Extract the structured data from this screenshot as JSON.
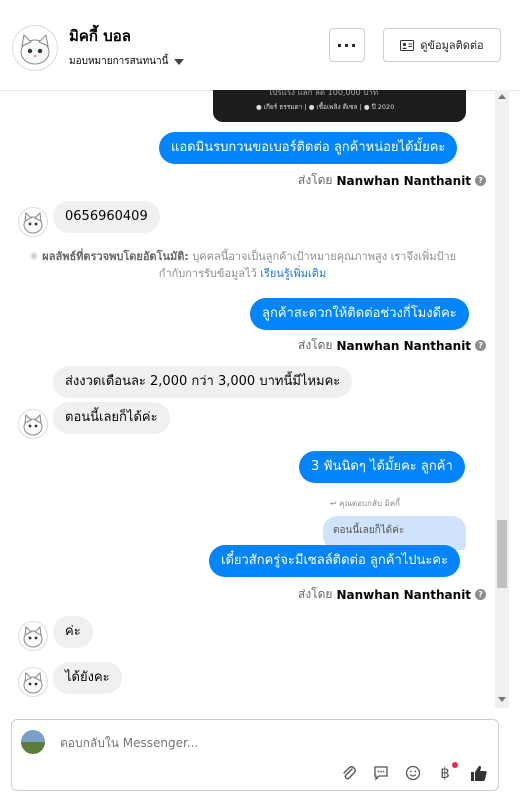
{
  "header": {
    "name": "มิคกี้ บอล",
    "assign_label": "มอบหมายการสนทนานี้",
    "more_label": "···",
    "contact_info_label": "ดูข้อมูลติดต่อ"
  },
  "promo": {
    "line1": "โปรแรง แลก ลด 100,000 บาท",
    "line2": "● เกียร์ ธรรมดา  |  ● เชื้อเพลิง ดีเซล  |  ● ปี 2020"
  },
  "messages": {
    "m1": "แอดมินรบกวนขอเบอร์ติดต่อ ลูกค้าหน่อยได้มั้ยคะ",
    "m2": "0656960409",
    "m3": "ลูกค้าสะดวกให้ติดต่อช่วงกี่โมงดีคะ",
    "m4": "ส่งงวดเดือนละ 2,000 กว่า 3,000 บาทนี้มีไหมคะ",
    "m5": "ตอนนี้เลยก็ได้ค่ะ",
    "m6": "3 ฟันนิดๆ ได้มั้ยคะ ลูกค้า",
    "m7": "เดี๋ยวสักครู่จะมีเซลล์ติดต่อ ลูกค้าไปนะคะ",
    "m8": "ค่ะ",
    "m9": "ได้ยังคะ"
  },
  "sent_by": {
    "prefix": "ส่งโดย",
    "name": "Nanwhan Nanthanit"
  },
  "auto_detect": {
    "label": "ผลลัพธ์ที่ตรวจพบโดยอัตโนมัติ:",
    "text": "บุคคลนี้อาจเป็นลูกค้าเป้าหมายคุณภาพสูง เราจึงเพิ่มป้ายกำกับการรับข้อมูลไว้",
    "link": "เรียนรู้เพิ่มเติม"
  },
  "reply": {
    "note": "คุณตอบกลับ มิคกี้",
    "quoted": "ตอนนี้เลยก็ได้ค่ะ"
  },
  "composer": {
    "placeholder": "ตอบกลับใน Messenger..."
  },
  "icons": {
    "attach": "paperclip-icon",
    "quick_reply": "chat-bubble-icon",
    "emoji": "smiley-icon",
    "payment": "baht-icon",
    "like": "thumbs-up-icon"
  },
  "colors": {
    "accent": "#0084ff",
    "incoming": "#f0f0f0",
    "link": "#1877f2"
  }
}
